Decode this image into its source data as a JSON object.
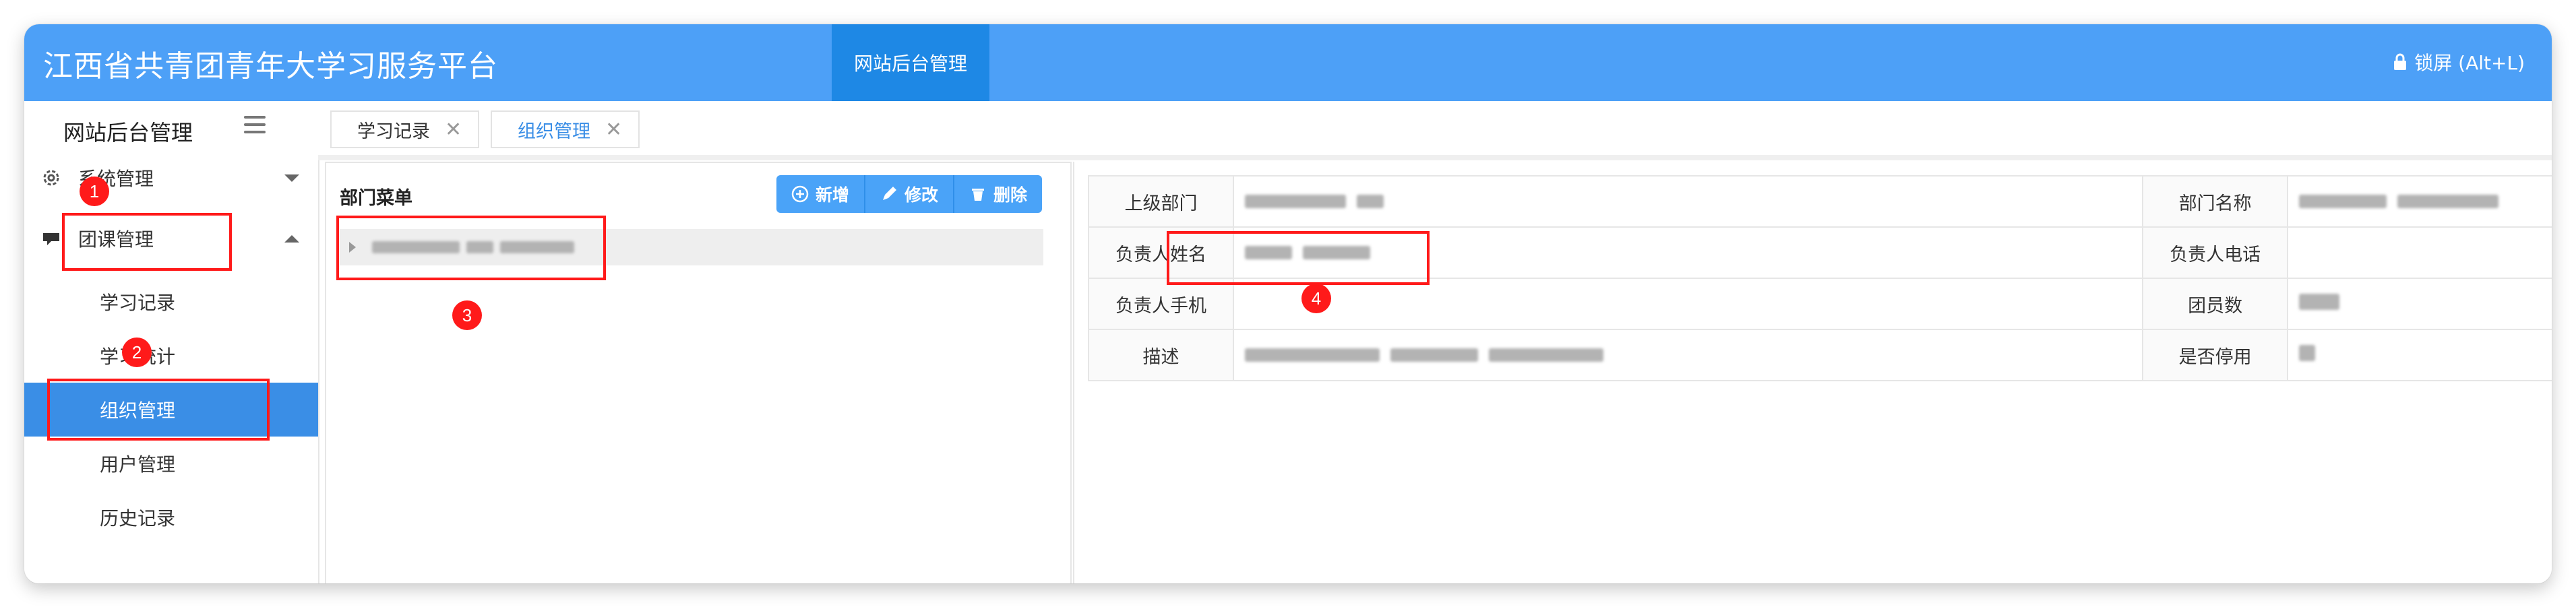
{
  "header": {
    "app_title": "江西省共青团青年大学习服务平台",
    "nav_tab": "网站后台管理",
    "lock_label": "锁屏 (Alt+L)"
  },
  "sidebar": {
    "title": "网站后台管理",
    "menus": [
      {
        "label": "系统管理",
        "icon": "gear-icon",
        "expanded": false
      },
      {
        "label": "团课管理",
        "icon": "chat-bubble-icon",
        "expanded": true
      }
    ],
    "sub_items": [
      {
        "label": "学习记录",
        "active": false
      },
      {
        "label": "学习统计",
        "active": false
      },
      {
        "label": "组织管理",
        "active": true
      },
      {
        "label": "用户管理",
        "active": false
      },
      {
        "label": "历史记录",
        "active": false
      }
    ]
  },
  "tabs": [
    {
      "label": "学习记录",
      "close": "✕",
      "active": false
    },
    {
      "label": "组织管理",
      "close": "✕",
      "active": true
    }
  ],
  "dept_panel": {
    "title": "部门菜单",
    "buttons": {
      "add": "新增",
      "edit": "修改",
      "delete": "删除"
    }
  },
  "details": {
    "rows": [
      {
        "label": "上级部门",
        "label2": "部门名称"
      },
      {
        "label": "负责人姓名",
        "label2": "负责人电话"
      },
      {
        "label": "负责人手机",
        "label2": "团员数"
      },
      {
        "label": "描述",
        "label2": "是否停用"
      }
    ]
  },
  "annotations": [
    "1",
    "2",
    "3",
    "4"
  ],
  "colors": {
    "header_blue": "#4da0f7",
    "nav_tab_blue": "#1e88e5",
    "active_item_blue": "#3a8ee6",
    "annotation_red": "#ff1a1a"
  }
}
